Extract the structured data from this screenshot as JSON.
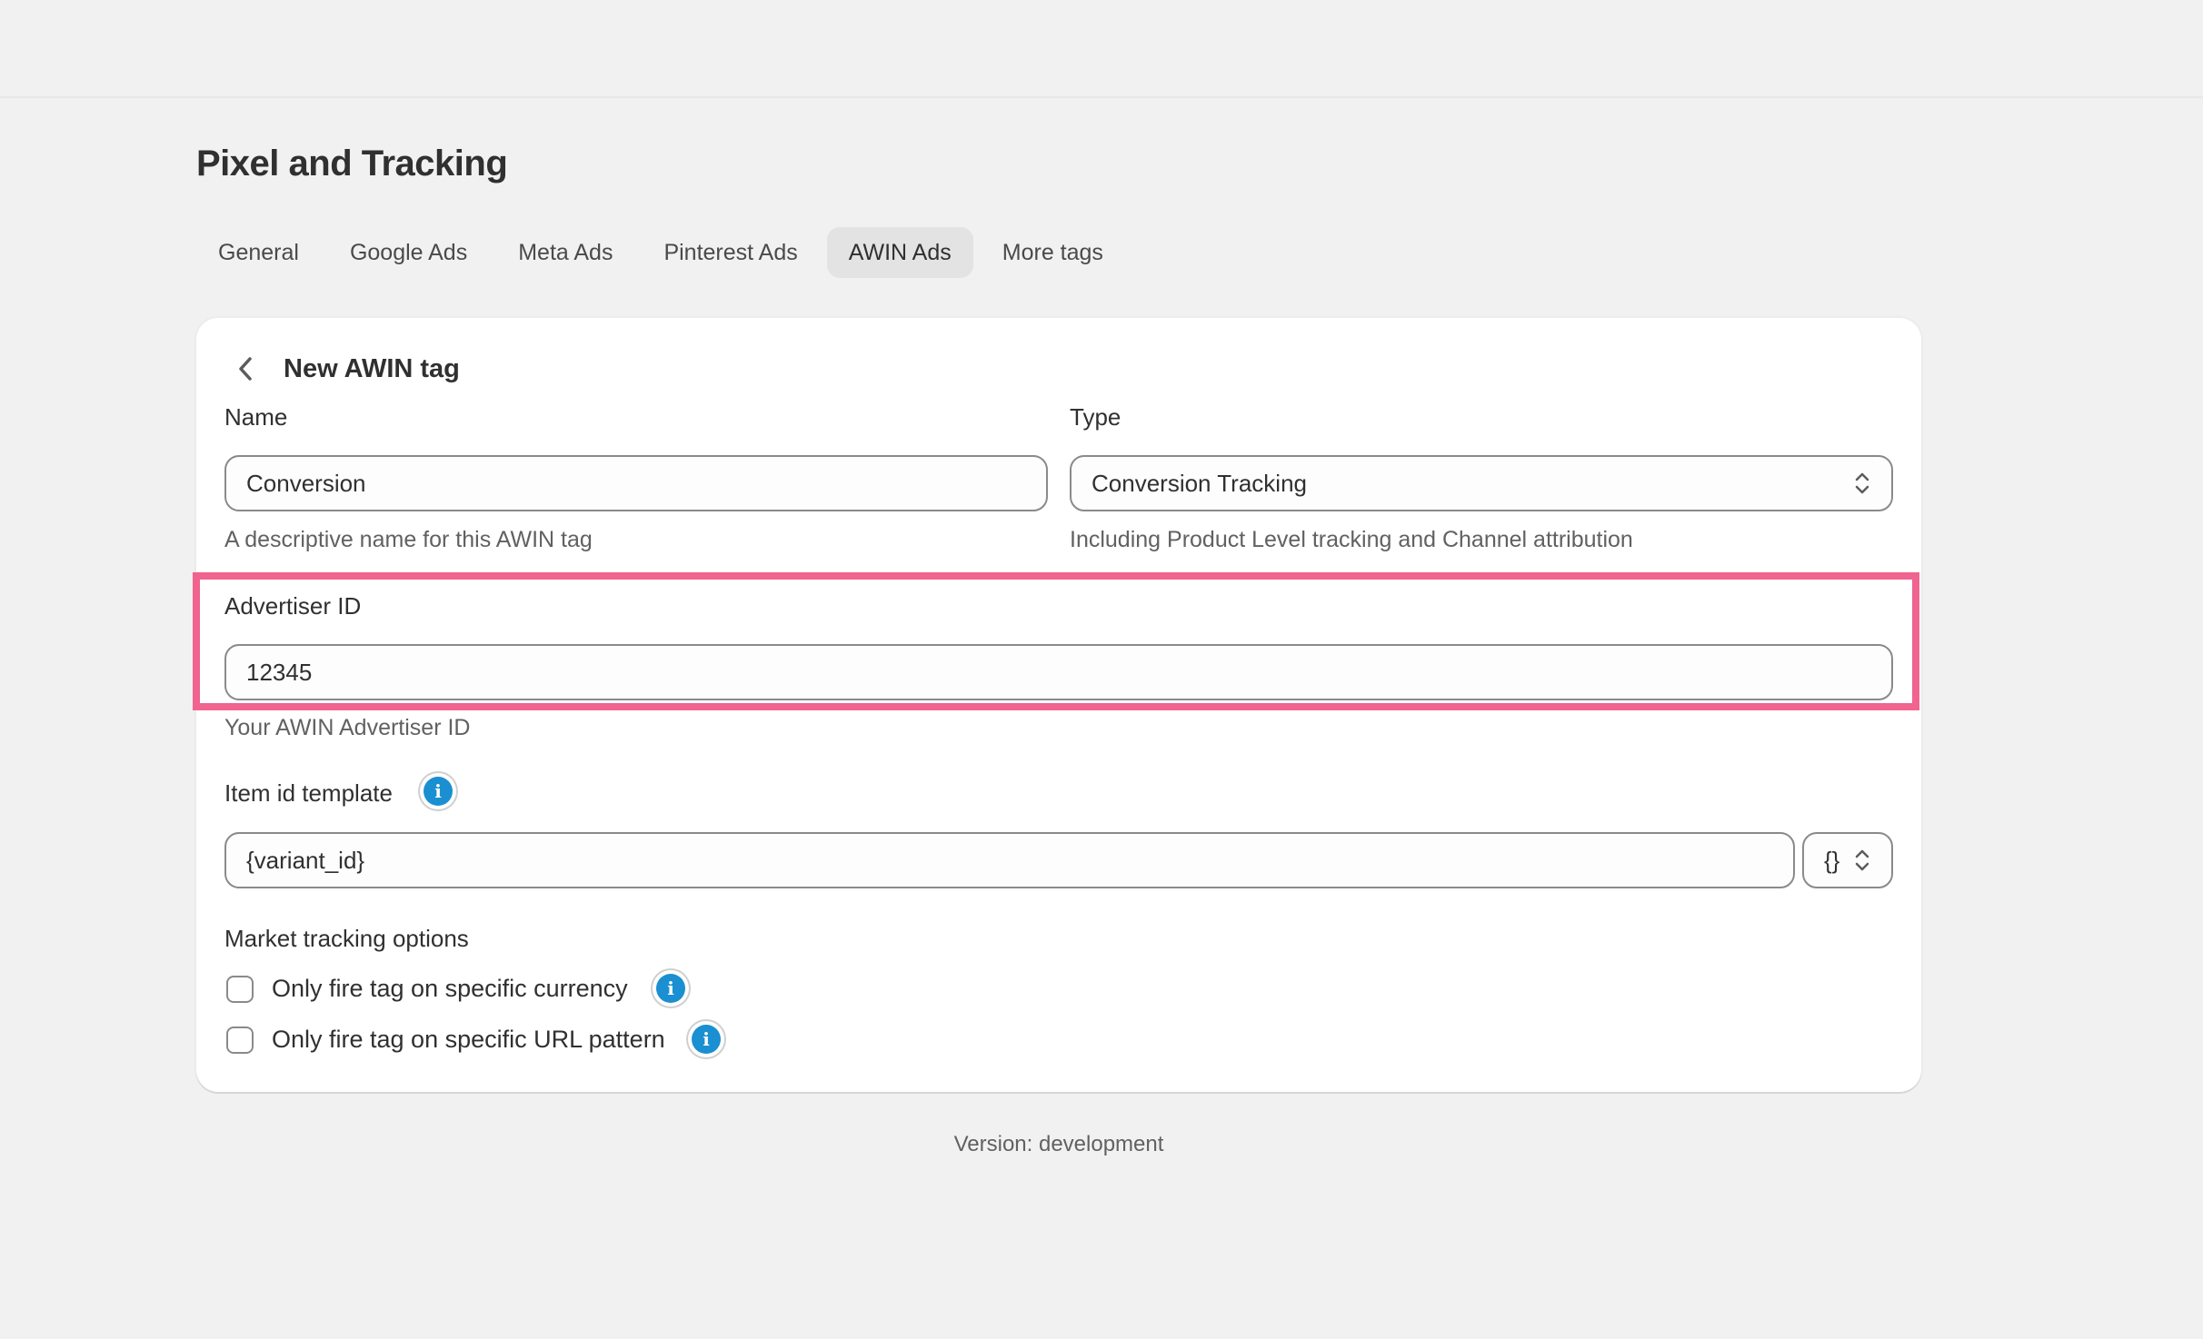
{
  "page": {
    "title": "Pixel and Tracking",
    "version_text": "Version: development"
  },
  "tabs": [
    {
      "label": "General",
      "active": false
    },
    {
      "label": "Google Ads",
      "active": false
    },
    {
      "label": "Meta Ads",
      "active": false
    },
    {
      "label": "Pinterest Ads",
      "active": false
    },
    {
      "label": "AWIN Ads",
      "active": true
    },
    {
      "label": "More tags",
      "active": false
    }
  ],
  "card": {
    "title": "New AWIN tag",
    "name": {
      "label": "Name",
      "value": "Conversion",
      "help": "A descriptive name for this AWIN tag"
    },
    "type": {
      "label": "Type",
      "value": "Conversion Tracking",
      "help": "Including Product Level tracking and Channel attribution"
    },
    "advertiser_id": {
      "label": "Advertiser ID",
      "value": "12345",
      "help": "Your AWIN Advertiser ID"
    },
    "item_id_template": {
      "label": "Item id template",
      "value": "{variant_id}",
      "variable_button": "{}"
    },
    "market_tracking": {
      "label": "Market tracking options",
      "options": [
        {
          "label": "Only fire tag on specific currency",
          "checked": false
        },
        {
          "label": "Only fire tag on specific URL pattern",
          "checked": false
        }
      ]
    }
  },
  "colors": {
    "highlight": "#f0648f",
    "info_icon": "#1a8fd1",
    "background": "#f1f1f1"
  },
  "icons": {
    "back": "chevron-left-icon",
    "select": "chevron-updown-icon",
    "info": "info-icon"
  }
}
